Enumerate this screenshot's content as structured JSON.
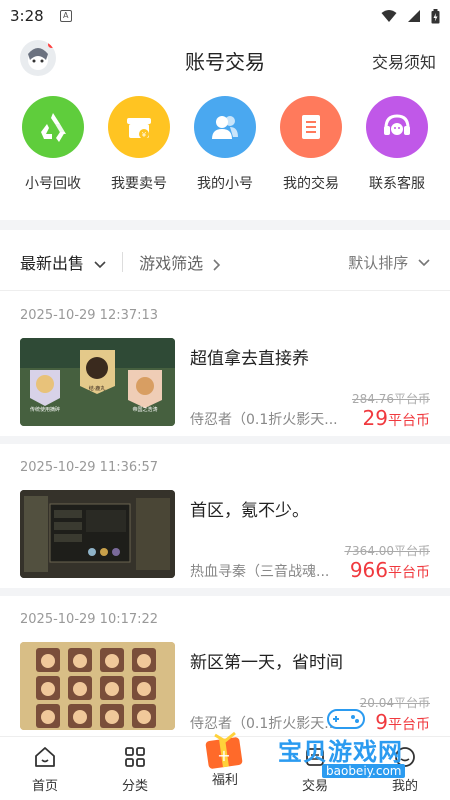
{
  "status_bar": {
    "time": "3:28",
    "notification_letter": "A"
  },
  "header": {
    "title": "账号交易",
    "notice_link": "交易须知"
  },
  "menu": [
    {
      "label": "小号回收",
      "icon": "recycle-icon",
      "color": "#5fcd3c"
    },
    {
      "label": "我要卖号",
      "icon": "shop-icon",
      "color": "#ffc422"
    },
    {
      "label": "我的小号",
      "icon": "users-icon",
      "color": "#4aa8f0"
    },
    {
      "label": "我的交易",
      "icon": "receipt-icon",
      "color": "#ff7a5c"
    },
    {
      "label": "联系客服",
      "icon": "headset-icon",
      "color": "#c058e8"
    }
  ],
  "filters": {
    "latest": "最新出售",
    "game_filter": "游戏筛选",
    "sort": "默认排序"
  },
  "listings": [
    {
      "timestamp": "2025-10-29 12:37:13",
      "title": "超值拿去直接养",
      "game": "侍忍者（0.1折火影天...",
      "original_price": "284.76平台币",
      "price": "29",
      "price_unit": "平台币",
      "thumb_text": [
        "传统使用摘碎",
        "结·鹿丸",
        "帝国之浩涛"
      ]
    },
    {
      "timestamp": "2025-10-29 11:36:57",
      "title": "首区，氪不少。",
      "game": "热血寻秦（三音战魂...",
      "original_price": "7364.00平台币",
      "price": "966",
      "price_unit": "平台币"
    },
    {
      "timestamp": "2025-10-29 10:17:22",
      "title": "新区第一天，省时间",
      "game": "侍忍者（0.1折火影天...",
      "original_price": "20.04平台币",
      "price": "9",
      "price_unit": "平台币"
    }
  ],
  "bottom_nav": [
    {
      "label": "首页",
      "icon": "home-icon"
    },
    {
      "label": "分类",
      "icon": "grid-icon"
    },
    {
      "label": "福利",
      "icon": "gift-icon"
    },
    {
      "label": "交易",
      "icon": "trade-icon"
    },
    {
      "label": "我的",
      "icon": "profile-icon"
    }
  ],
  "watermark": {
    "title": "宝贝游戏网",
    "domain": "baobeiy.com"
  },
  "colors": {
    "price": "#f0393e",
    "muted": "#999999",
    "accent_blue": "#2b9bf0"
  }
}
